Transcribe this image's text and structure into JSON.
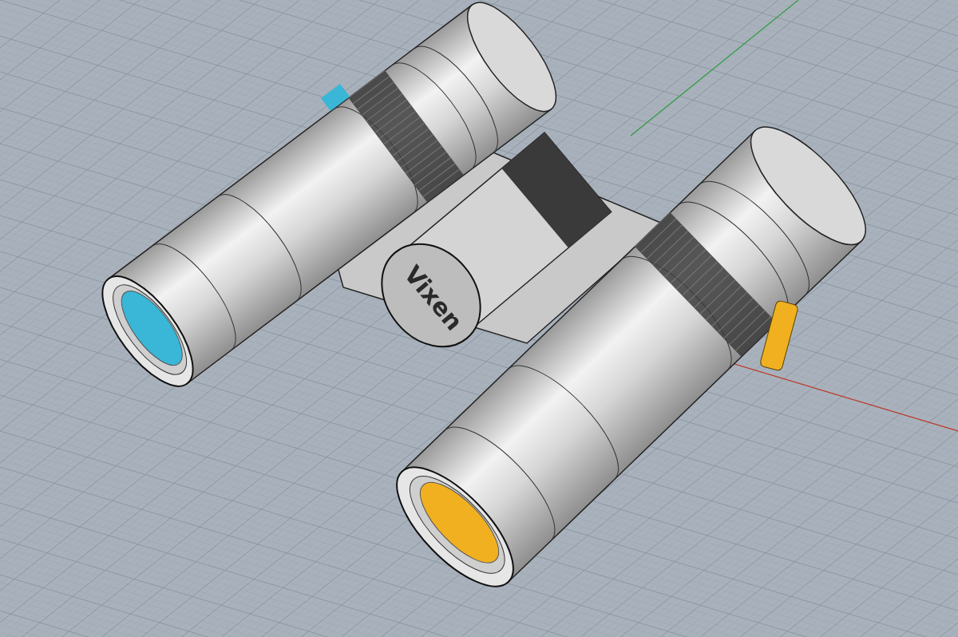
{
  "viewport": {
    "model_logo": "Vixen"
  }
}
